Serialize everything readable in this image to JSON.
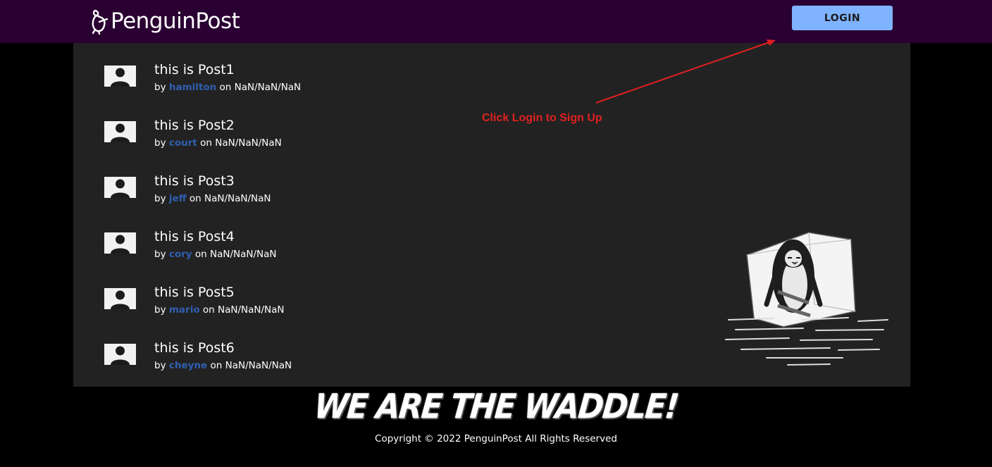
{
  "header": {
    "brand": "PenguinPost",
    "login_label": "LOGIN",
    "background": "#2a0033",
    "login_color": "#7fb3ff"
  },
  "posts": [
    {
      "title": "this is Post1",
      "by": "by",
      "author": "hamilton",
      "on": "on NaN/NaN/NaN"
    },
    {
      "title": "this is Post2",
      "by": "by",
      "author": "court",
      "on": "on NaN/NaN/NaN"
    },
    {
      "title": "this is Post3",
      "by": "by",
      "author": "jeff",
      "on": "on NaN/NaN/NaN"
    },
    {
      "title": "this is Post4",
      "by": "by",
      "author": "cory",
      "on": "on NaN/NaN/NaN"
    },
    {
      "title": "this is Post5",
      "by": "by",
      "author": "mario",
      "on": "on NaN/NaN/NaN"
    },
    {
      "title": "this is Post6",
      "by": "by",
      "author": "cheyne",
      "on": "on NaN/NaN/NaN"
    }
  ],
  "annotation": {
    "text": "Click Login to Sign Up",
    "color": "#e02020"
  },
  "footer": {
    "slogan": "WE ARE THE WADDLE!",
    "copyright": "Copyright © 2022 PenguinPost All Rights Reserved"
  },
  "icons": {
    "logo": "penguin-logo-icon",
    "avatar": "user-avatar-icon",
    "illustration": "penguin-in-ice-icon"
  }
}
